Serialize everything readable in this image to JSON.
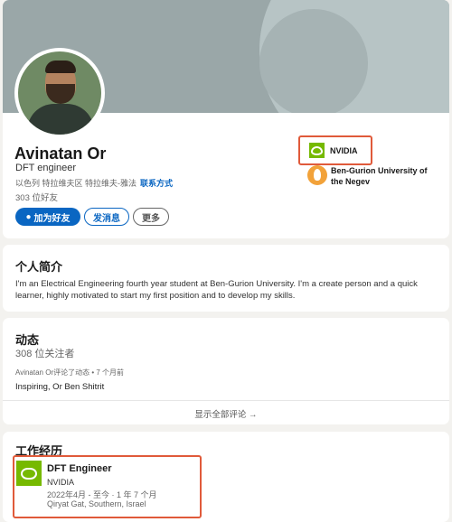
{
  "profile": {
    "name": "Avinatan Or",
    "headline": "DFT engineer",
    "location": "以色列 特拉维夫区 特拉维夫-雅法",
    "contact_link": "联系方式",
    "connections": "303 位好友",
    "buttons": {
      "add": "加为好友",
      "message": "发消息",
      "more": "更多"
    },
    "current_company": "NVIDIA",
    "school": "Ben-Gurion University of the Negev"
  },
  "about": {
    "title": "个人简介",
    "text": "I'm an Electrical Engineering fourth year student at Ben-Gurion University. I'm a create person and a quick learner, highly motivated to start my first position and to develop my skills."
  },
  "activity": {
    "title": "动态",
    "followers": "308 位关注者",
    "meta": "Avinatan Or评论了动态 • 7 个月前",
    "text": "Inspiring, Or Ben Shitrit",
    "show_all": "显示全部评论 →"
  },
  "experience": {
    "title": "工作经历",
    "items": [
      {
        "role": "DFT Engineer",
        "company": "NVIDIA",
        "dates": "2022年4月 - 至今 · 1 年 7 个月",
        "location": "Qiryat Gat, Southern, Israel"
      }
    ]
  },
  "colors": {
    "accent": "#0a66c2",
    "nvidia": "#76b900",
    "highlight": "#e05a3a"
  }
}
